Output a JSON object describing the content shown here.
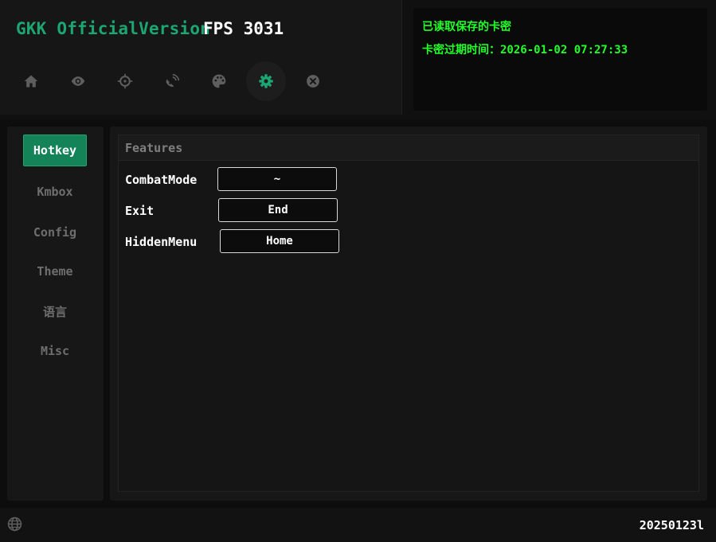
{
  "header": {
    "brand": "GKK OfficialVersion",
    "fps": "FPS 3031",
    "tabs": [
      {
        "name": "home",
        "icon": "home-icon",
        "active": false
      },
      {
        "name": "visuals",
        "icon": "eye-icon",
        "active": false
      },
      {
        "name": "aim",
        "icon": "crosshair-icon",
        "active": false
      },
      {
        "name": "radar",
        "icon": "satellite-icon",
        "active": false
      },
      {
        "name": "theme",
        "icon": "palette-icon",
        "active": false
      },
      {
        "name": "settings",
        "icon": "gear-icon",
        "active": true
      },
      {
        "name": "exit",
        "icon": "close-circle-icon",
        "active": false
      }
    ]
  },
  "license": {
    "line1": "已读取保存的卡密",
    "line2": "卡密过期时间：2026-01-02 07:27:33",
    "color": "#22ff2a"
  },
  "sidebar": {
    "items": [
      {
        "label": "Hotkey",
        "active": true
      },
      {
        "label": "Kmbox",
        "active": false
      },
      {
        "label": "Config",
        "active": false
      },
      {
        "label": "Theme",
        "active": false
      },
      {
        "label": "语言",
        "active": false
      },
      {
        "label": "Misc",
        "active": false
      }
    ]
  },
  "features": {
    "title": "Features",
    "rows": [
      {
        "label": "CombatMode",
        "key": "~"
      },
      {
        "label": "Exit",
        "key": "End"
      },
      {
        "label": "HiddenMenu",
        "key": "Home"
      }
    ]
  },
  "footer": {
    "icon": "globe-icon",
    "version": "20250123l"
  },
  "colors": {
    "accent": "#1ba672",
    "accent_active_bg": "#158358",
    "inactive_icon": "#5e5e5e",
    "background": "#0d0d0d"
  }
}
